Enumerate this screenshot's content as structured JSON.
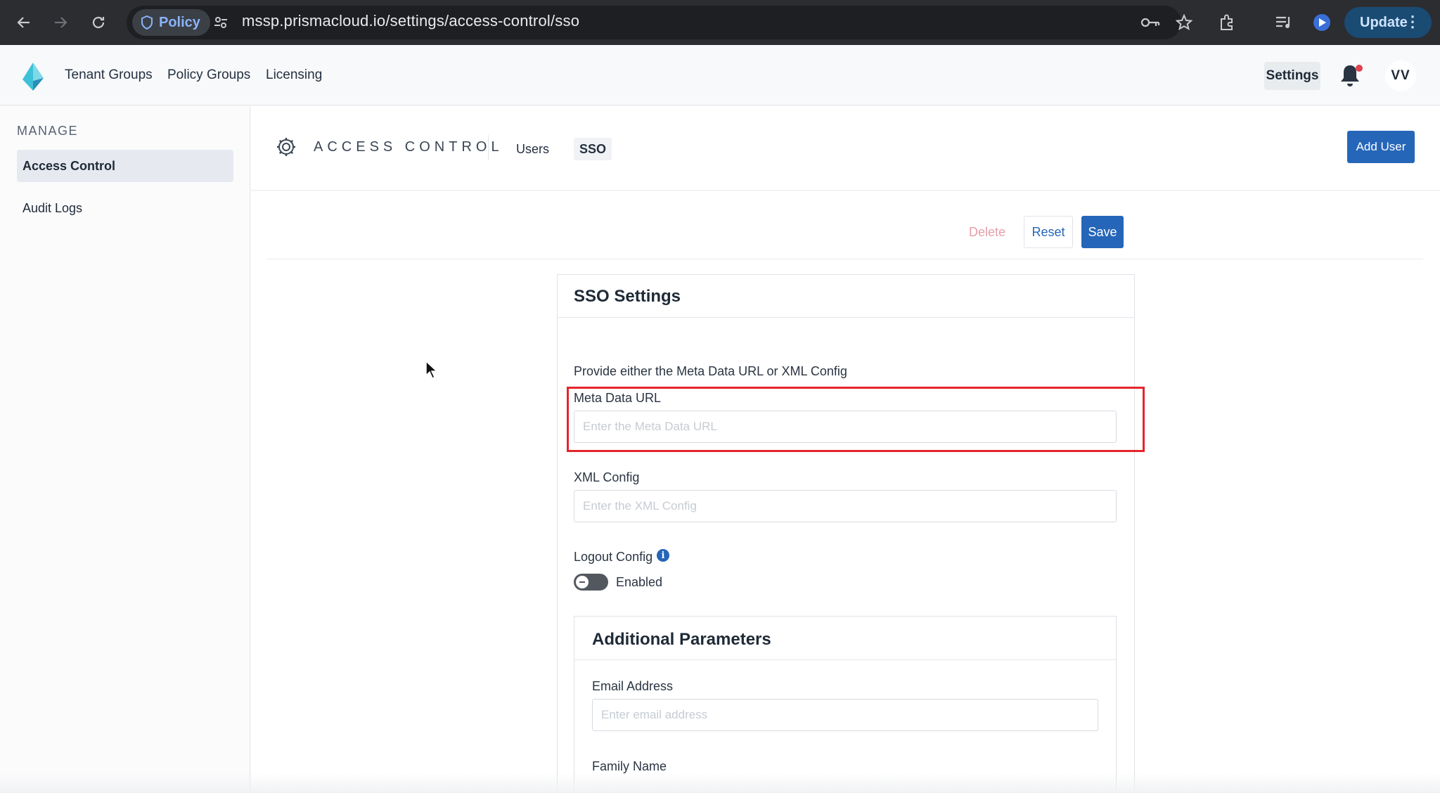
{
  "browser": {
    "policy_chip": "Policy",
    "url": "mssp.prismacloud.io/settings/access-control/sso",
    "update_label": "Update",
    "icons": [
      "back-icon",
      "forward-icon",
      "reload-icon",
      "shield-icon",
      "site-settings-icon",
      "key-icon",
      "star-icon",
      "extensions-icon",
      "media-icon",
      "profile-icon",
      "menu-icon"
    ]
  },
  "header": {
    "nav": [
      "Tenant Groups",
      "Policy Groups",
      "Licensing"
    ],
    "settings_label": "Settings",
    "avatar_initials": "VV",
    "notification_dot_color": "#e0424f"
  },
  "sidebar": {
    "section_label": "MANAGE",
    "items": [
      {
        "label": "Access Control",
        "active": true
      },
      {
        "label": "Audit Logs",
        "active": false
      }
    ]
  },
  "page": {
    "title": "ACCESS CONTROL",
    "tabs": [
      {
        "label": "Users",
        "active": false
      },
      {
        "label": "SSO",
        "active": true
      }
    ],
    "add_user_label": "Add User"
  },
  "actions": {
    "delete_label": "Delete",
    "reset_label": "Reset",
    "save_label": "Save"
  },
  "sso": {
    "title": "SSO Settings",
    "help_text": "Provide either the Meta Data URL or XML Config",
    "meta_url_label": "Meta Data URL",
    "meta_url_placeholder": "Enter the Meta Data URL",
    "meta_url_value": "",
    "xml_label": "XML Config",
    "xml_placeholder": "Enter the XML Config",
    "xml_value": "",
    "logout_label": "Logout Config",
    "logout_toggle_label": "Enabled",
    "logout_enabled": false,
    "additional": {
      "title": "Additional Parameters",
      "email_label": "Email Address",
      "email_placeholder": "Enter email address",
      "family_name_label": "Family Name"
    }
  },
  "colors": {
    "primary": "#2566b8",
    "highlight_box": "#e3262b",
    "chrome_bg": "#2b2d31"
  }
}
